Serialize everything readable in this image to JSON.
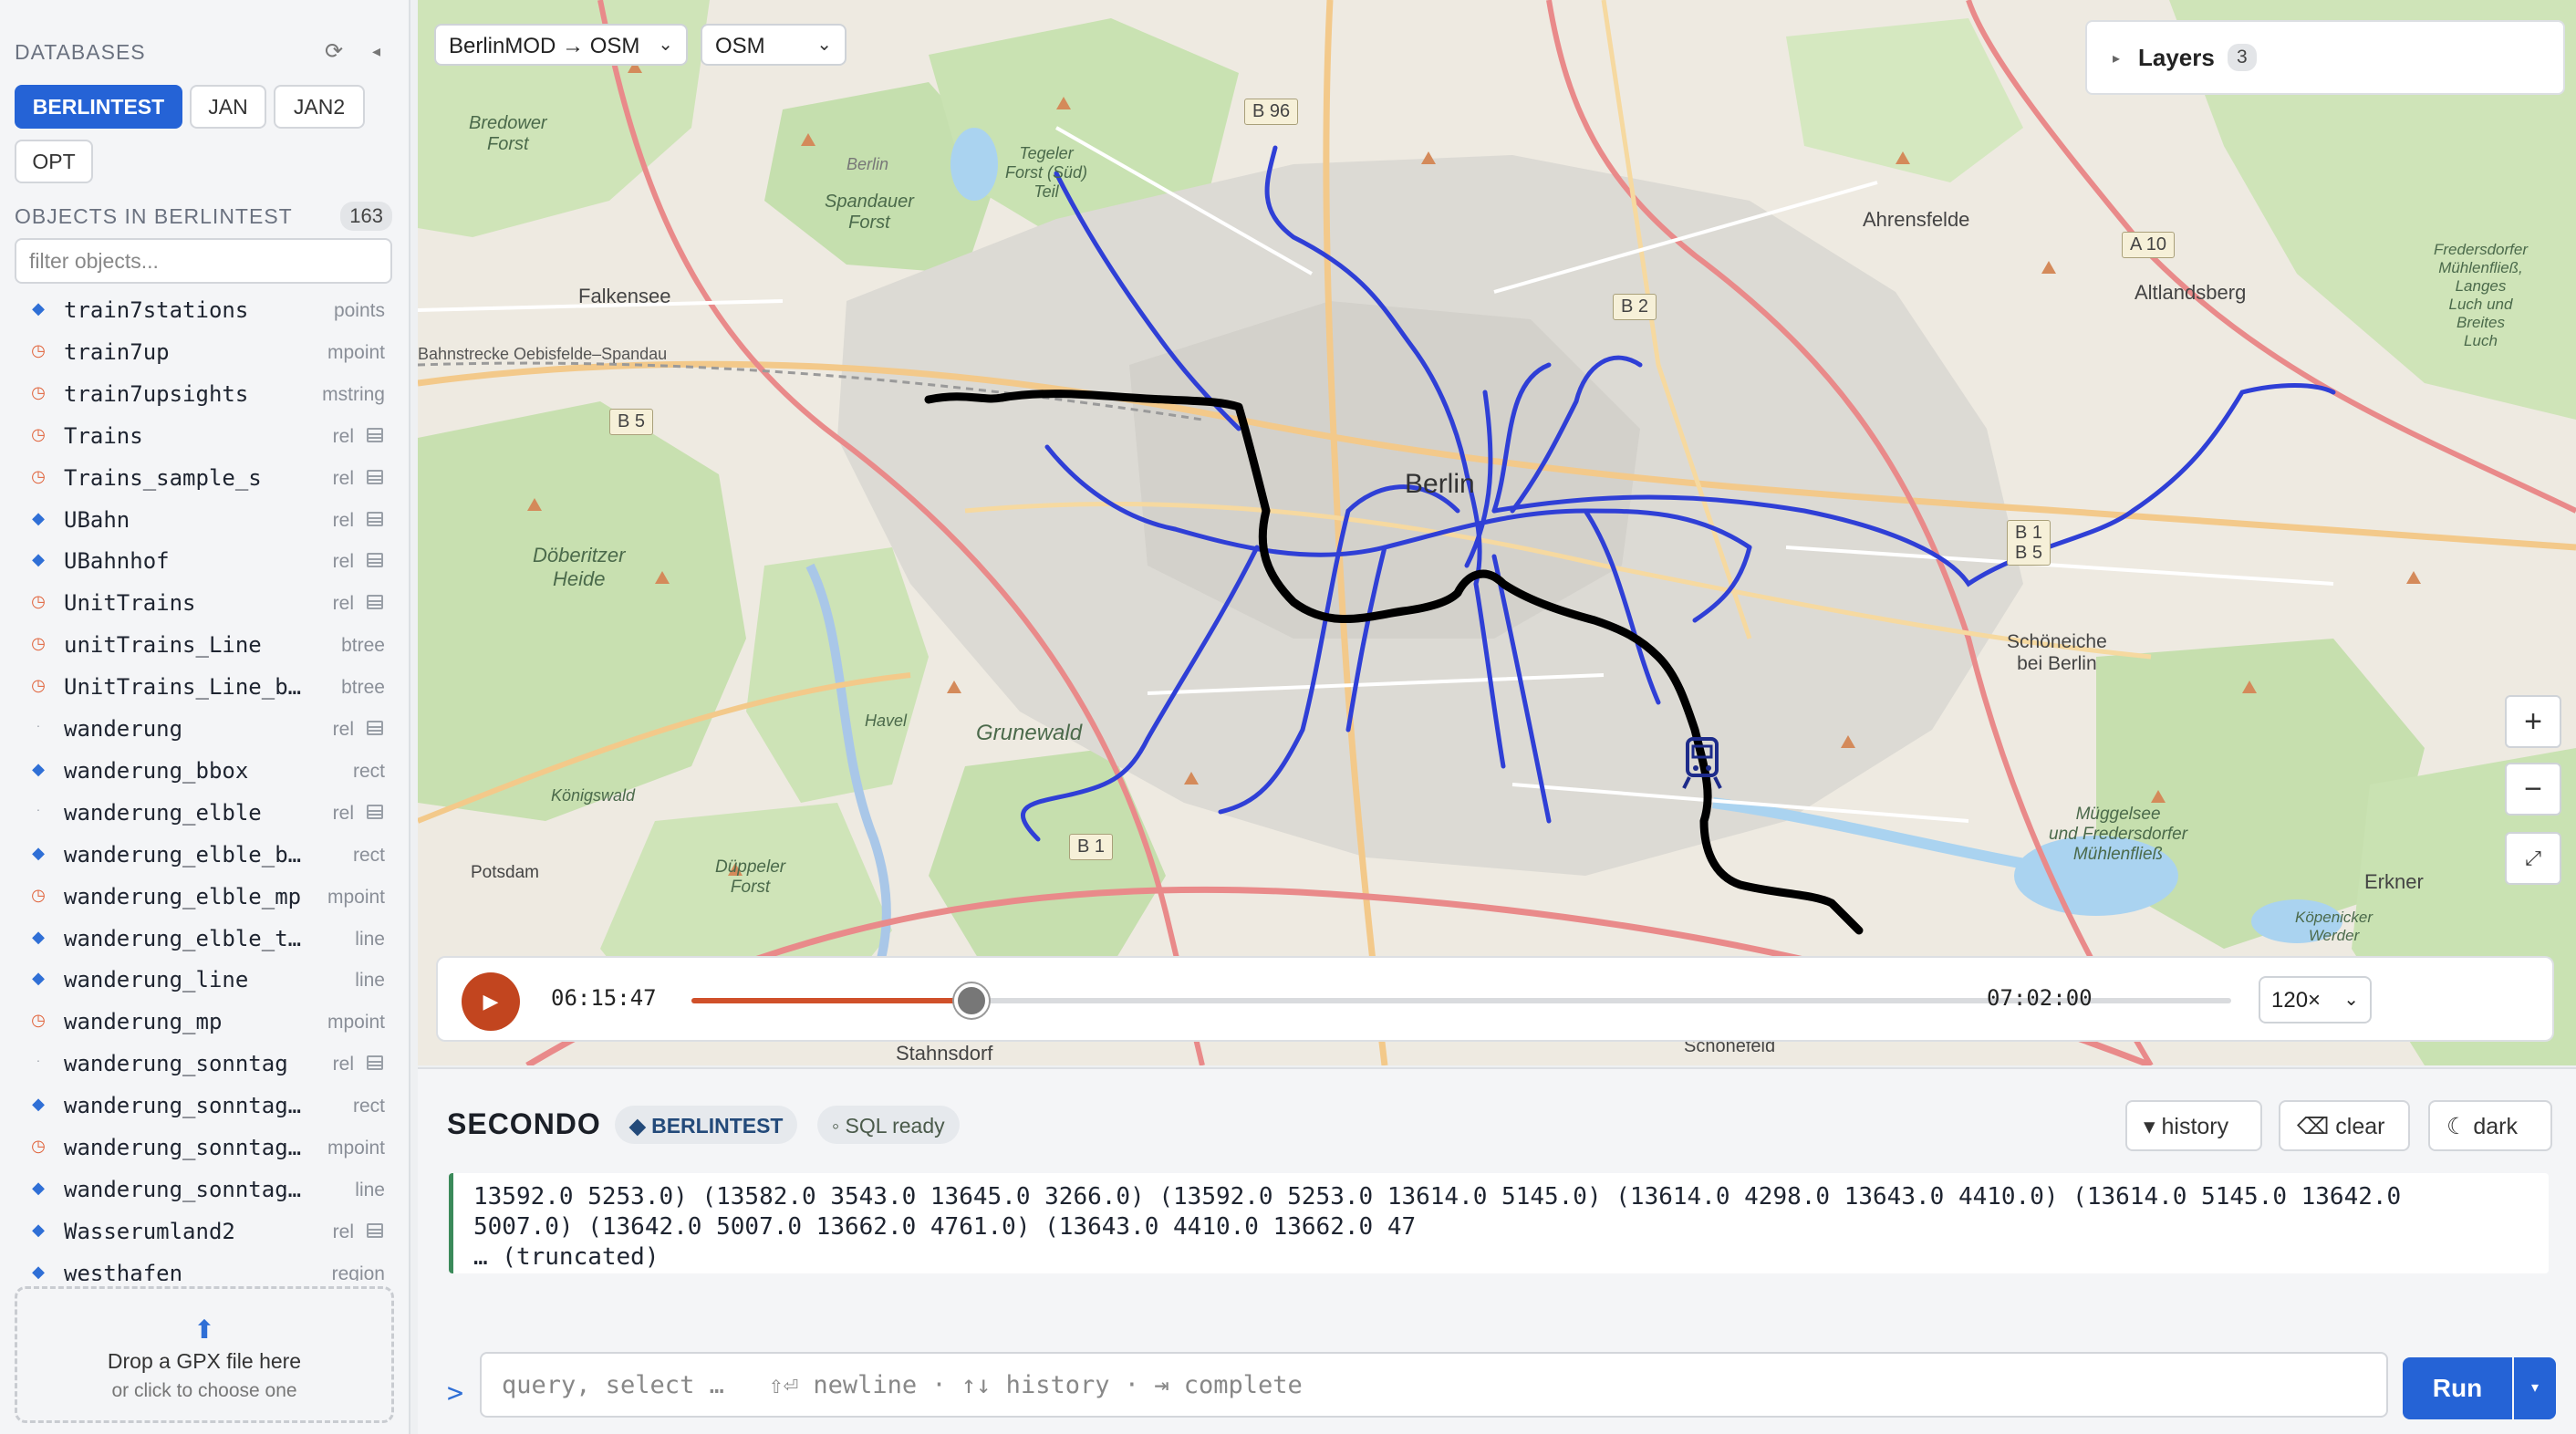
{
  "sidebar": {
    "databases_label": "DATABASES",
    "refresh_icon": "refresh-icon",
    "collapse_icon": "collapse-icon",
    "databases": [
      {
        "label": "BERLINTEST",
        "active": true
      },
      {
        "label": "JAN",
        "active": false
      },
      {
        "label": "JAN2",
        "active": false
      },
      {
        "label": "OPT",
        "active": false
      }
    ],
    "objects_label": "OBJECTS IN BERLINTEST",
    "objects_count": "163",
    "filter_placeholder": "filter objects...",
    "objects": [
      {
        "name": "train7stations",
        "type": "points",
        "icon": "diamond",
        "table": false
      },
      {
        "name": "train7up",
        "type": "mpoint",
        "icon": "clock",
        "table": false
      },
      {
        "name": "train7upsights",
        "type": "mstring",
        "icon": "clock",
        "table": false
      },
      {
        "name": "Trains",
        "type": "rel",
        "icon": "clock",
        "table": true
      },
      {
        "name": "Trains_sample_s",
        "type": "rel",
        "icon": "clock",
        "table": true
      },
      {
        "name": "UBahn",
        "type": "rel",
        "icon": "diamond",
        "table": true
      },
      {
        "name": "UBahnhof",
        "type": "rel",
        "icon": "diamond",
        "table": true
      },
      {
        "name": "UnitTrains",
        "type": "rel",
        "icon": "clock",
        "table": true
      },
      {
        "name": "unitTrains_Line",
        "type": "btree",
        "icon": "clock",
        "table": false
      },
      {
        "name": "UnitTrains_Line_bt…",
        "type": "btree",
        "icon": "clock",
        "table": false
      },
      {
        "name": "wanderung",
        "type": "rel",
        "icon": "small",
        "table": true
      },
      {
        "name": "wanderung_bbox",
        "type": "rect",
        "icon": "diamond",
        "table": false
      },
      {
        "name": "wanderung_elble",
        "type": "rel",
        "icon": "small",
        "table": true
      },
      {
        "name": "wanderung_elble_bbox",
        "type": "rect",
        "icon": "diamond",
        "table": false
      },
      {
        "name": "wanderung_elble_mp",
        "type": "mpoint",
        "icon": "clock",
        "table": false
      },
      {
        "name": "wanderung_elble_tra…",
        "type": "line",
        "icon": "diamond",
        "table": false
      },
      {
        "name": "wanderung_line",
        "type": "line",
        "icon": "diamond",
        "table": false
      },
      {
        "name": "wanderung_mp",
        "type": "mpoint",
        "icon": "clock",
        "table": false
      },
      {
        "name": "wanderung_sonntag",
        "type": "rel",
        "icon": "small",
        "table": true
      },
      {
        "name": "wanderung_sonntag_b…",
        "type": "rect",
        "icon": "diamond",
        "table": false
      },
      {
        "name": "wanderung_sonntag…",
        "type": "mpoint",
        "icon": "clock",
        "table": false
      },
      {
        "name": "wanderung_sonntag_t…",
        "type": "line",
        "icon": "diamond",
        "table": false
      },
      {
        "name": "Wasserumland2",
        "type": "rel",
        "icon": "diamond",
        "table": true
      },
      {
        "name": "westhafen",
        "type": "region",
        "icon": "diamond",
        "table": false
      }
    ],
    "drop_title": "Drop a GPX file here",
    "drop_subtitle": "or click to choose one",
    "drop_icon": "upload-arrow-icon"
  },
  "map": {
    "projection_select": "BerlinMOD → OSM",
    "tiles_select": "OSM",
    "layers_label": "Layers",
    "layers_count": "3",
    "zoom_in": "+",
    "zoom_out": "−",
    "fullscreen_icon": "expand-icon",
    "labels": {
      "berlin": "Berlin",
      "falkensee": "Falkensee",
      "ahrensfelde": "Ahrensfelde",
      "altlandsberg": "Altlandsberg",
      "schoeneiche": "Schöneiche\nbei Berlin",
      "erkner": "Erkner",
      "stahnsdorf": "Stahnsdorf",
      "schoenefeld": "Schönefeld",
      "bredower": "Bredower\nForst",
      "spandauer": "Spandauer\nForst",
      "tegeler": "Tegeler\nForst (Süd)\nTeil",
      "doeberitzer": "Döberitzer\nHeide",
      "grunewald": "Grunewald",
      "koenigswald": "Königswald",
      "duppeler": "Düppeler\nForst",
      "potsdam": "Potsdam",
      "mueggelsee": "Müggelsee\nund Fredersdorfer\nMühlenfließ",
      "fredersdorfer": "Fredersdorfer\nMühlenfließ,\nLanges\nLuch und\nBreites\nLuch",
      "koepenicker": "Köpenicker\nWerder",
      "havel": "Havel",
      "bahnstrecke": "Bahnstrecke Oebisfelde–Spandau",
      "berlin_small": "Berlin"
    },
    "roads": [
      "B 96",
      "A 10",
      "B 2",
      "B 5",
      "B 1\nB 5",
      "B 1"
    ],
    "playback": {
      "current_time": "06:15:47",
      "end_time": "07:02:00",
      "progress_fraction": 0.182,
      "speed": "120×"
    },
    "play_icon": "play-icon"
  },
  "console": {
    "title": "SECONDO",
    "db_pill": "◆ BERLINTEST",
    "sql_pill": "◦ SQL ready",
    "history_btn": "▾ history",
    "clear_btn": "⌫ clear",
    "dark_btn": "☾ dark",
    "output_lines": [
      "13592.0 5253.0) (13582.0 3543.0 13645.0 3266.0) (13592.0 5253.0 13614.0 5145.0) (13614.0 4298.0 13643.0 4410.0) (13614.0 5145.0 13642.0",
      "5007.0) (13642.0 5007.0 13662.0 4761.0) (13643.0 4410.0 13662.0 47",
      "… (truncated)"
    ],
    "prompt": ">",
    "query_placeholder": "query, select …   ⇧⏎ newline · ↑↓ history · ⇥ complete",
    "run_label": "Run",
    "run_more": "▾"
  }
}
